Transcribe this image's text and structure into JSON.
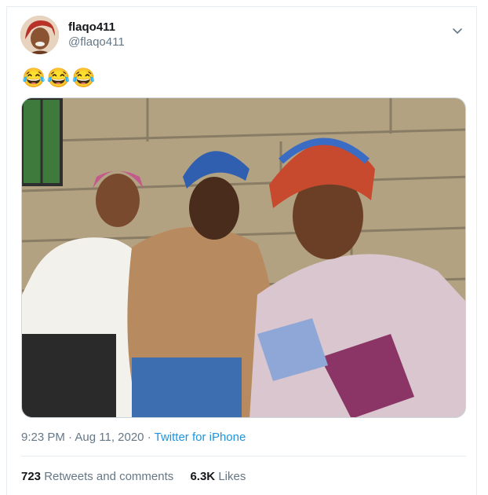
{
  "tweet": {
    "display_name": "flaqo411",
    "handle": "@flaqo411",
    "text_emojis": "😂😂😂",
    "time": "9:23 PM",
    "separator": "·",
    "date": "Aug 11, 2020",
    "source": "Twitter for iPhone",
    "retweets_count": "723",
    "retweets_label": "Retweets and comments",
    "likes_count": "6.3K",
    "likes_label": "Likes"
  },
  "icons": {
    "menu": "chevron-down-icon"
  },
  "colors": {
    "link": "#1b95e0",
    "secondary_text": "#657786",
    "border": "#e6ecf0"
  }
}
